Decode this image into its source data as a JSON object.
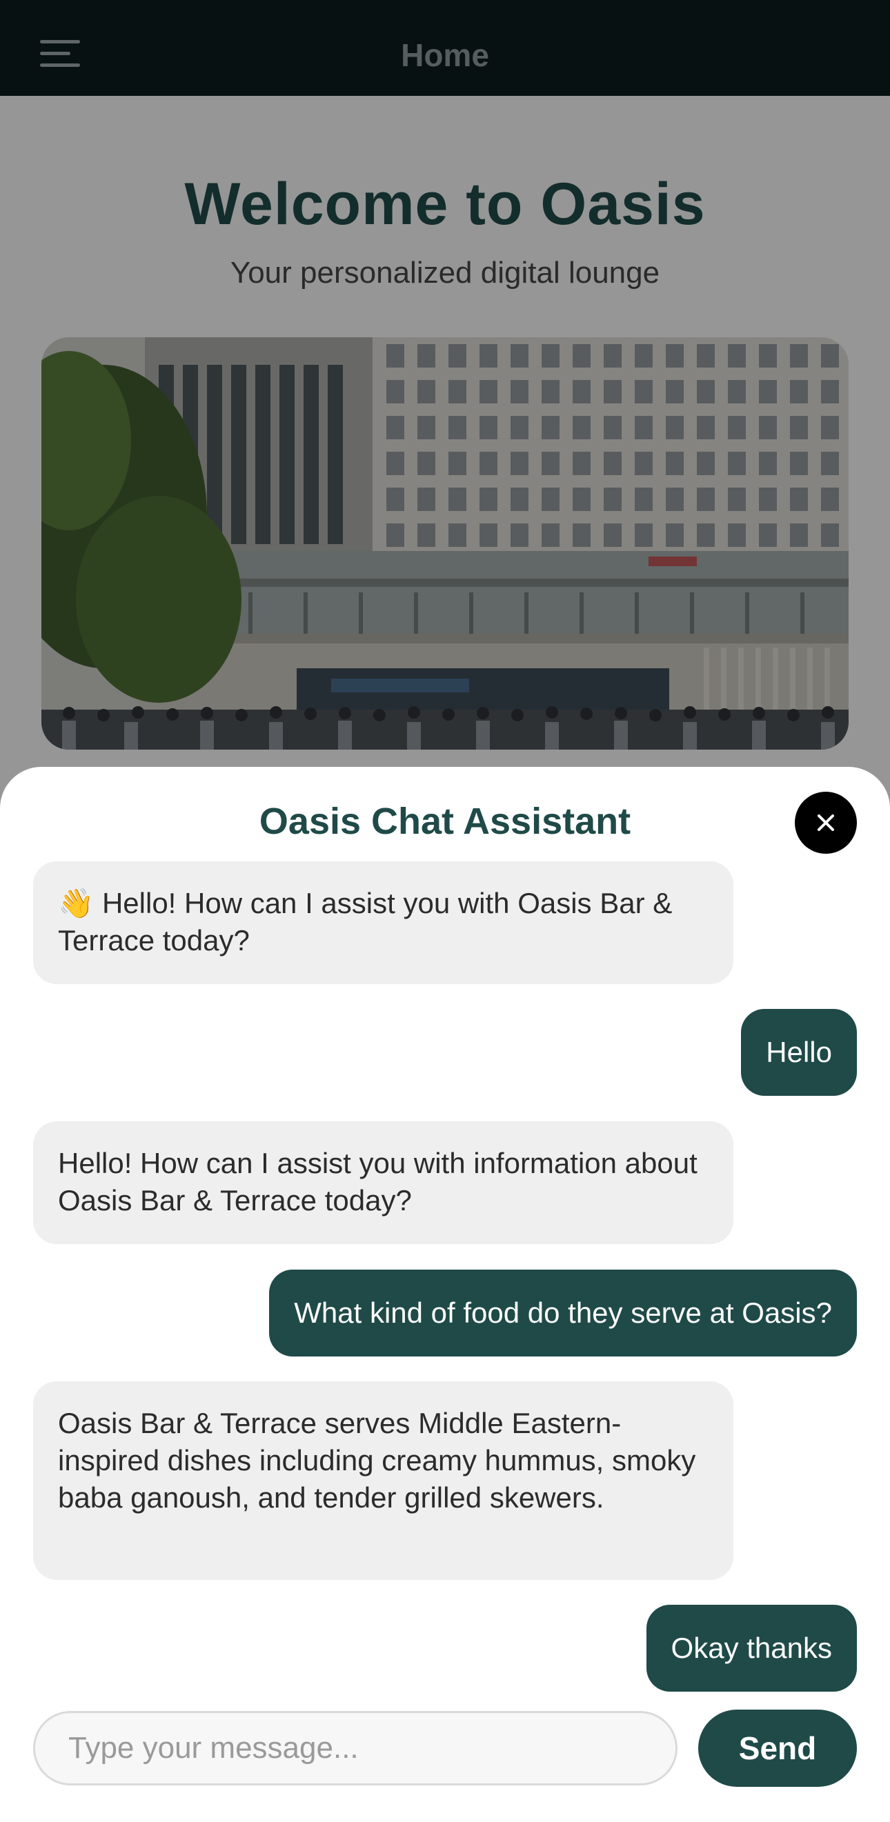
{
  "header": {
    "title": "Home",
    "menu_icon": "hamburger-menu-icon"
  },
  "hero": {
    "title": "Welcome to Oasis",
    "subtitle": "Your personalized digital lounge",
    "image_description_icon": "building-photo"
  },
  "chat": {
    "title": "Oasis Chat Assistant",
    "close_icon": "close-icon",
    "messages": [
      {
        "role": "assistant",
        "emoji": "👋",
        "text": " Hello! How can I assist you with Oasis Bar & Terrace today?"
      },
      {
        "role": "user",
        "text": "Hello"
      },
      {
        "role": "assistant",
        "text": "Hello! How can I assist you with information about Oasis Bar & Terrace today?"
      },
      {
        "role": "user",
        "text": "What kind of food do they serve at Oasis?"
      },
      {
        "role": "assistant",
        "text": "Oasis Bar & Terrace serves Middle Eastern-inspired dishes including creamy hummus, smoky baba ganoush, and tender grilled skewers."
      },
      {
        "role": "user",
        "text": "Okay thanks"
      }
    ],
    "input_placeholder": "Type your message...",
    "input_value": "",
    "send_label": "Send"
  },
  "colors": {
    "topbar": "#0c1c1d",
    "brand": "#1f4a48",
    "bot_bubble": "#efefef",
    "user_bubble": "#1f4a48"
  }
}
